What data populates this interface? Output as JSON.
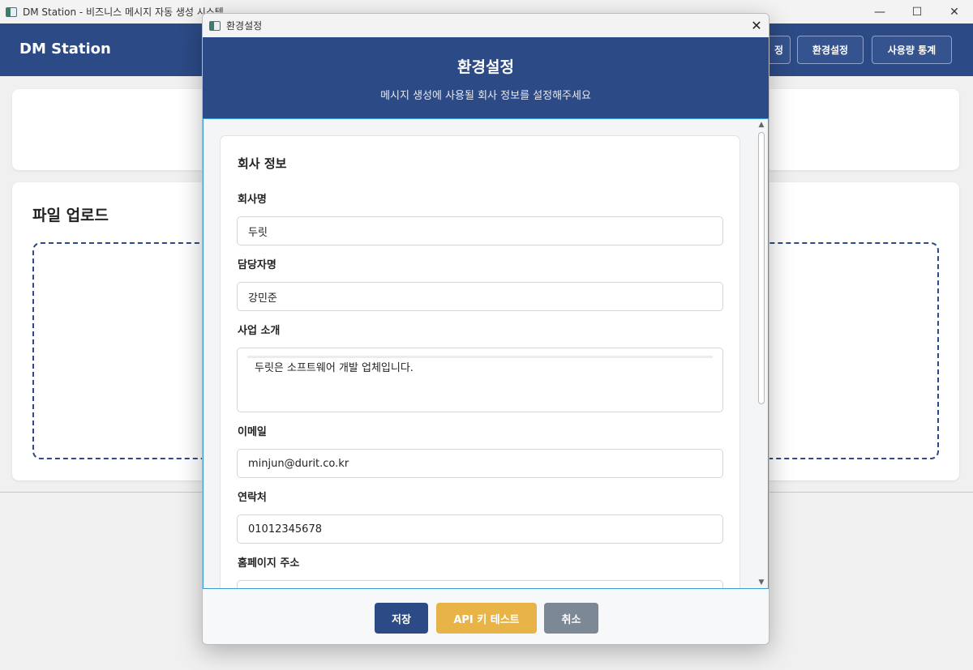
{
  "main_window": {
    "title": "DM Station - 비즈니스 메시지 자동 생성 시스템",
    "controls": {
      "minimize": "—",
      "maximize": "☐",
      "close": "✕"
    },
    "brand": "DM Station",
    "header_buttons": [
      "정",
      "환경설정",
      "사용량 통계"
    ],
    "upload_card_title": "파일 업로드"
  },
  "dialog": {
    "window_title": "환경설정",
    "close_glyph": "✕",
    "header_title": "환경설정",
    "header_subtitle": "메시지 생성에 사용될 회사 정보를 설정해주세요",
    "section_title": "회사 정보",
    "fields": {
      "company_name": {
        "label": "회사명",
        "value": "두릿"
      },
      "manager_name": {
        "label": "담당자명",
        "value": "강민준"
      },
      "business_intro": {
        "label": "사업 소개",
        "value": "두릿은 소프트웨어 개발 업체입니다."
      },
      "email": {
        "label": "이메일",
        "value": "minjun@durit.co.kr"
      },
      "phone": {
        "label": "연락처",
        "value": "01012345678"
      },
      "homepage": {
        "label": "홈페이지 주소",
        "value": ""
      }
    },
    "scroll_up": "▲",
    "scroll_down": "▼",
    "buttons": {
      "save": "저장",
      "api_test": "API 키 테스트",
      "cancel": "취소"
    }
  },
  "colors": {
    "header_blue": "#2c4a85",
    "save_button": "#2c4a85",
    "api_button": "#e8b447",
    "cancel_button": "#7d8896",
    "focus_border": "#3b9bd8"
  }
}
